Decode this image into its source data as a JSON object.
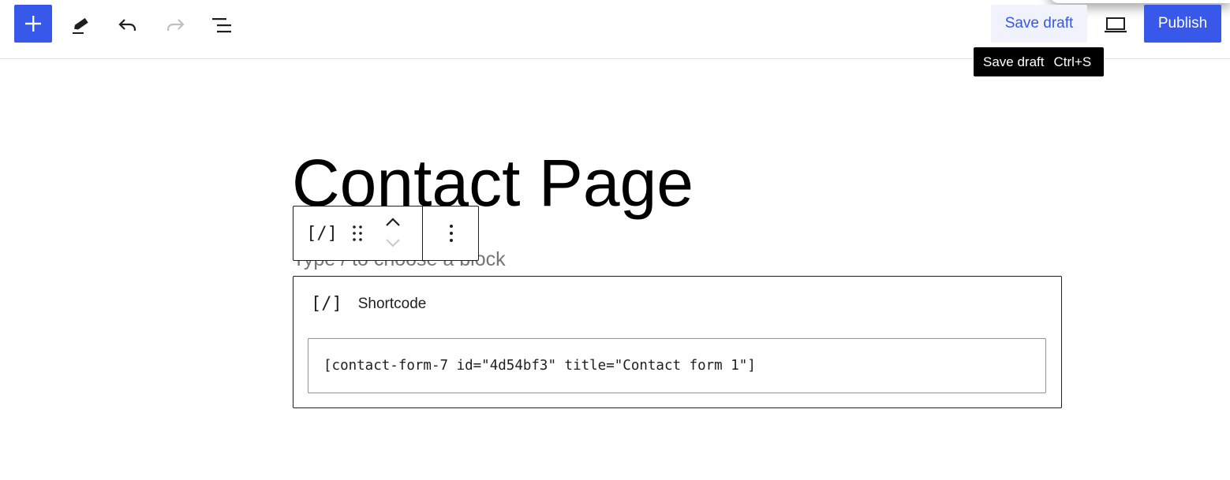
{
  "toolbar": {
    "add_block_icon": "plus-icon",
    "tools_icon": "pencil-icon",
    "undo_icon": "undo-icon",
    "redo_icon": "redo-icon",
    "list_view_icon": "list-view-icon",
    "save_draft_label": "Save draft",
    "preview_icon": "laptop-icon",
    "publish_label": "Publish"
  },
  "tooltip": {
    "label": "Save draft",
    "shortcut": "Ctrl+S"
  },
  "post": {
    "title": "Contact Page",
    "placeholder": "Type / to choose a block"
  },
  "block_toolbar": {
    "block_icon": "[/]",
    "drag_icon": "drag-handle-icon",
    "move_up_icon": "chevron-up-icon",
    "move_down_icon": "chevron-down-icon",
    "options_icon": "more-vertical-icon"
  },
  "shortcode_block": {
    "icon": "[/]",
    "label": "Shortcode",
    "value": "[contact-form-7 id=\"4d54bf3\" title=\"Contact form 1\"]"
  },
  "colors": {
    "accent": "#3858e9",
    "save_draft_bg": "#f0f3fb",
    "tooltip_bg": "#000000",
    "text": "#1e1e1e",
    "placeholder": "#757575"
  }
}
